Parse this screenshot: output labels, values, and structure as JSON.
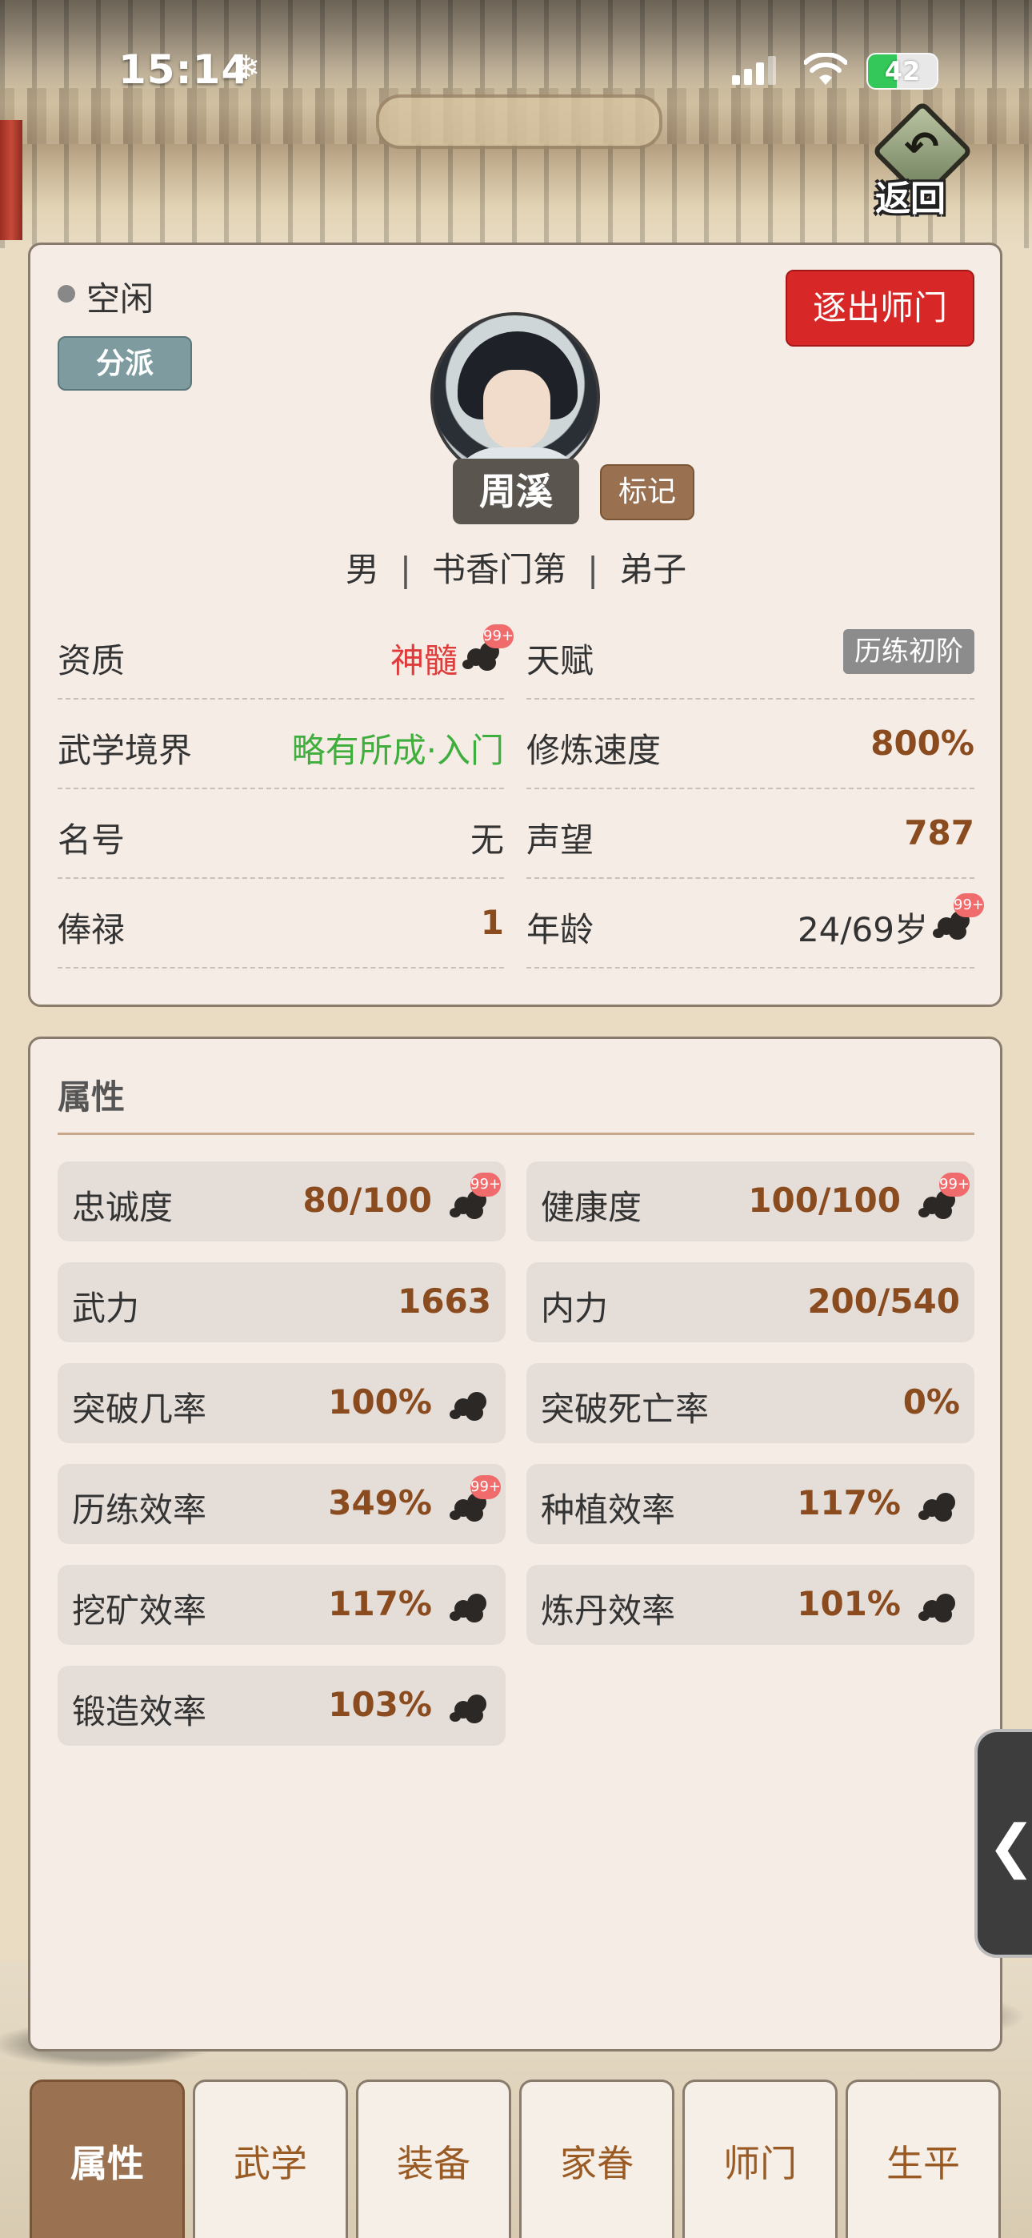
{
  "status_bar": {
    "time": "15:14",
    "extra_icon": "snowflake-icon",
    "battery": "42",
    "battery_level": 0.42
  },
  "header": {
    "back_label": "返回"
  },
  "profile": {
    "status": "空闲",
    "faction_button": "分派",
    "expel_button": "逐出师门",
    "name": "周溪",
    "mark_button": "标记",
    "gender": "男",
    "background": "书香门第",
    "role": "弟子",
    "info": [
      {
        "label": "资质",
        "value": "神髓",
        "badge": "99+"
      },
      {
        "label": "天赋",
        "value": "历练初阶"
      },
      {
        "label": "武学境界",
        "value": "略有所成·入门"
      },
      {
        "label": "修炼速度",
        "value": "800%"
      },
      {
        "label": "名号",
        "value": "无"
      },
      {
        "label": "声望",
        "value": "787"
      },
      {
        "label": "俸禄",
        "value": "1"
      },
      {
        "label": "年龄",
        "value": "24/69岁",
        "badge": "99+"
      }
    ]
  },
  "attributes": {
    "title": "属性",
    "stats": [
      {
        "label": "忠诚度",
        "value": "80/100",
        "badge": "99+"
      },
      {
        "label": "健康度",
        "value": "100/100",
        "badge": "99+"
      },
      {
        "label": "武力",
        "value": "1663"
      },
      {
        "label": "内力",
        "value": "200/540"
      },
      {
        "label": "突破几率",
        "value": "100%"
      },
      {
        "label": "突破死亡率",
        "value": "0%"
      },
      {
        "label": "历练效率",
        "value": "349%",
        "badge": "99+"
      },
      {
        "label": "种植效率",
        "value": "117%"
      },
      {
        "label": "挖矿效率",
        "value": "117%"
      },
      {
        "label": "炼丹效率",
        "value": "101%"
      },
      {
        "label": "锻造效率",
        "value": "103%"
      }
    ]
  },
  "side_handle": {
    "glyph": "❮"
  },
  "tabs": [
    "属性",
    "武学",
    "装备",
    "家眷",
    "师门",
    "生平"
  ],
  "colors": {
    "accent_red": "#d82727",
    "value_brown": "#8a4b1f",
    "tab_active": "#9a7251",
    "green": "#3fae3d"
  }
}
